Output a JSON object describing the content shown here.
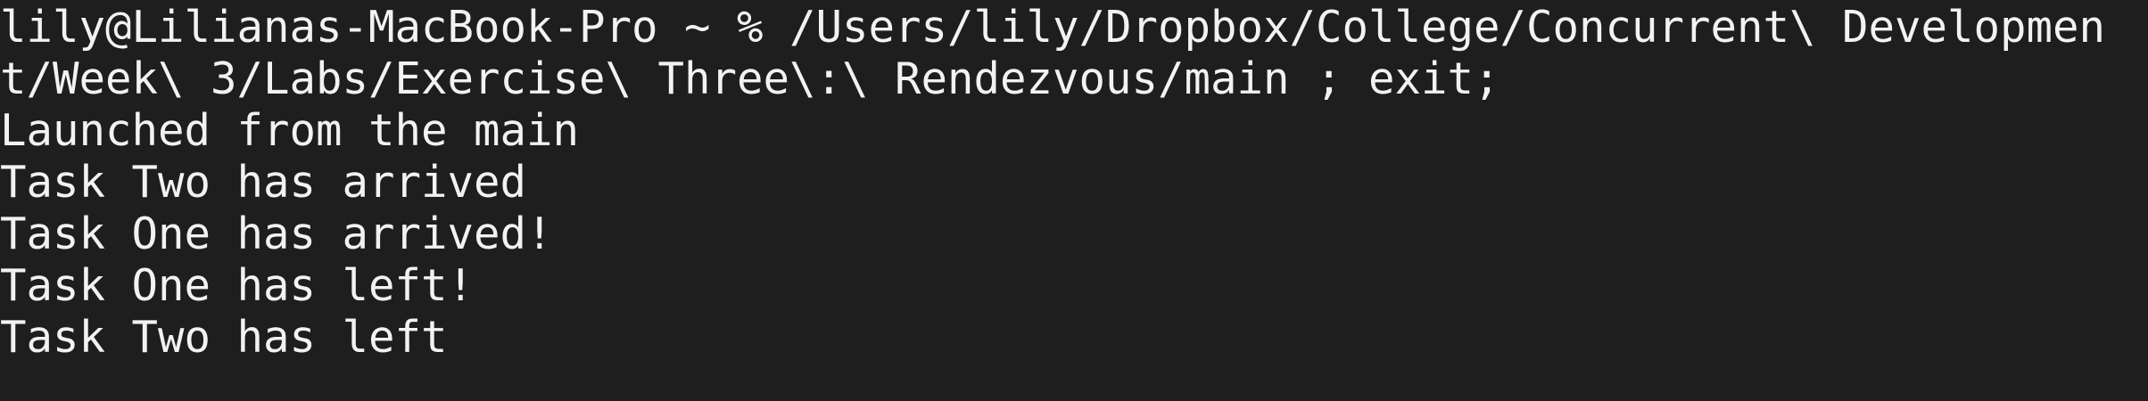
{
  "terminal": {
    "lines": [
      "lily@Lilianas-MacBook-Pro ~ % /Users/lily/Dropbox/College/Concurrent\\ Developmen",
      "t/Week\\ 3/Labs/Exercise\\ Three\\:\\ Rendezvous/main ; exit;",
      "Launched from the main",
      "Task Two has arrived",
      "Task One has arrived!",
      "Task One has left!",
      "Task Two has left"
    ]
  },
  "colors": {
    "background": "#1e1e1e",
    "foreground": "#f2f2f2"
  }
}
